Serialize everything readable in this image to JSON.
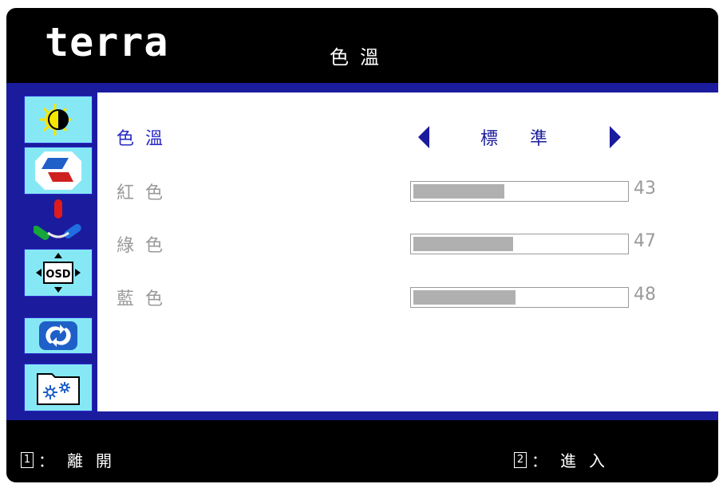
{
  "header": {
    "logo": "terra",
    "title": "色溫"
  },
  "sidebar": {
    "items": [
      {
        "name": "brightness-contrast",
        "selected": false
      },
      {
        "name": "image-position",
        "selected": false
      },
      {
        "name": "color",
        "selected": true
      },
      {
        "name": "osd-position",
        "selected": false
      },
      {
        "name": "reset",
        "selected": false
      },
      {
        "name": "settings",
        "selected": false
      }
    ]
  },
  "main": {
    "color_temp": {
      "label": "色溫",
      "value": "標準"
    },
    "sliders": [
      {
        "label": "紅色",
        "value": "43",
        "fraction": 0.43
      },
      {
        "label": "綠色",
        "value": "47",
        "fraction": 0.47
      },
      {
        "label": "藍色",
        "value": "48",
        "fraction": 0.48
      }
    ]
  },
  "footer": {
    "left": {
      "key": "1",
      "text": "：離開"
    },
    "right": {
      "key": "2",
      "text": "：進入"
    }
  },
  "colors": {
    "frame": "#000000",
    "accent": "#1b1b9e",
    "tile": "#86e8f5",
    "active_text": "#2929c8",
    "inactive_text": "#9a9a9a",
    "slider_fill": "#b0b0b0"
  }
}
